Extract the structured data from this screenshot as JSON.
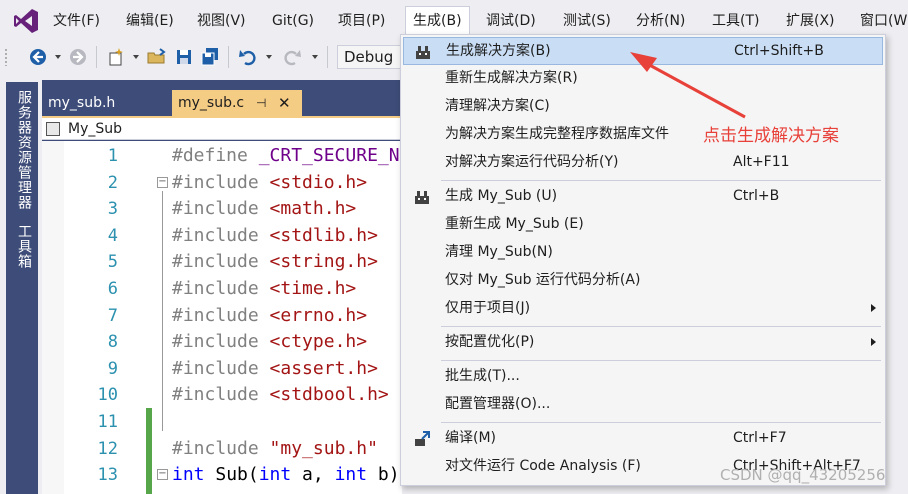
{
  "menubar": {
    "items": [
      "文件(F)",
      "编辑(E)",
      "视图(V)",
      "Git(G)",
      "项目(P)",
      "生成(B)",
      "调试(D)",
      "测试(S)",
      "分析(N)",
      "工具(T)",
      "扩展(X)",
      "窗口(W)"
    ],
    "active_index": 5
  },
  "toolbar": {
    "configuration": "Debug",
    "icons": [
      "back-icon",
      "forward-icon",
      "new-project-icon",
      "open-folder-icon",
      "save-icon",
      "save-all-icon",
      "undo-icon",
      "redo-icon"
    ]
  },
  "left_strip": {
    "server_explorer": "服务器资源管理器",
    "toolbox": "工具箱"
  },
  "tabs": [
    {
      "label": "my_sub.h",
      "active": false
    },
    {
      "label": "my_sub.c",
      "active": true
    }
  ],
  "navbar": {
    "scope": "My_Sub"
  },
  "code_lines": [
    {
      "n": "1",
      "fold": false,
      "parts": [
        {
          "c": "pp",
          "t": "#define "
        },
        {
          "c": "macro",
          "t": "_CRT_SECURE_NO"
        }
      ]
    },
    {
      "n": "2",
      "fold": true,
      "parts": [
        {
          "c": "pp",
          "t": "#include "
        },
        {
          "c": "hdr",
          "t": "<stdio.h>"
        }
      ]
    },
    {
      "n": "3",
      "fold": false,
      "parts": [
        {
          "c": "pp",
          "t": "#include "
        },
        {
          "c": "hdr",
          "t": "<math.h>"
        }
      ]
    },
    {
      "n": "4",
      "fold": false,
      "parts": [
        {
          "c": "pp",
          "t": "#include "
        },
        {
          "c": "hdr",
          "t": "<stdlib.h>"
        }
      ]
    },
    {
      "n": "5",
      "fold": false,
      "parts": [
        {
          "c": "pp",
          "t": "#include "
        },
        {
          "c": "hdr",
          "t": "<string.h>"
        }
      ]
    },
    {
      "n": "6",
      "fold": false,
      "parts": [
        {
          "c": "pp",
          "t": "#include "
        },
        {
          "c": "hdr",
          "t": "<time.h>"
        }
      ]
    },
    {
      "n": "7",
      "fold": false,
      "parts": [
        {
          "c": "pp",
          "t": "#include "
        },
        {
          "c": "hdr",
          "t": "<errno.h>"
        }
      ]
    },
    {
      "n": "8",
      "fold": false,
      "parts": [
        {
          "c": "pp",
          "t": "#include "
        },
        {
          "c": "hdr",
          "t": "<ctype.h>"
        }
      ]
    },
    {
      "n": "9",
      "fold": false,
      "parts": [
        {
          "c": "pp",
          "t": "#include "
        },
        {
          "c": "hdr",
          "t": "<assert.h>"
        }
      ]
    },
    {
      "n": "10",
      "fold": false,
      "parts": [
        {
          "c": "pp",
          "t": "#include "
        },
        {
          "c": "hdr",
          "t": "<stdbool.h>"
        }
      ]
    },
    {
      "n": "11",
      "fold": false,
      "parts": []
    },
    {
      "n": "12",
      "fold": false,
      "parts": [
        {
          "c": "pp",
          "t": "#include "
        },
        {
          "c": "hdr",
          "t": "\"my_sub.h\""
        }
      ]
    },
    {
      "n": "13",
      "fold": true,
      "parts": [
        {
          "c": "kw",
          "t": "int"
        },
        {
          "c": "plain",
          "t": " Sub("
        },
        {
          "c": "kw",
          "t": "int"
        },
        {
          "c": "plain",
          "t": " a, "
        },
        {
          "c": "kw",
          "t": "int"
        },
        {
          "c": "plain",
          "t": " b)"
        }
      ]
    }
  ],
  "build_menu": {
    "items": [
      {
        "label": "生成解决方案(B)",
        "shortcut": "Ctrl+Shift+B",
        "icon": "build-icon",
        "highlight": true
      },
      {
        "label": "重新生成解决方案(R)",
        "shortcut": ""
      },
      {
        "label": "清理解决方案(C)",
        "shortcut": ""
      },
      {
        "label": "为解决方案生成完整程序数据库文件",
        "shortcut": ""
      },
      {
        "label": "对解决方案运行代码分析(Y)",
        "shortcut": "Alt+F11"
      },
      {
        "sep": true
      },
      {
        "label": "生成 My_Sub (U)",
        "shortcut": "Ctrl+B",
        "icon": "build-icon"
      },
      {
        "label": "重新生成 My_Sub (E)",
        "shortcut": ""
      },
      {
        "label": "清理 My_Sub(N)",
        "shortcut": ""
      },
      {
        "label": "仅对 My_Sub 运行代码分析(A)",
        "shortcut": ""
      },
      {
        "label": "仅用于项目(J)",
        "shortcut": "",
        "submenu": true
      },
      {
        "sep": true
      },
      {
        "label": "按配置优化(P)",
        "shortcut": "",
        "submenu": true
      },
      {
        "sep": true
      },
      {
        "label": "批生成(T)...",
        "shortcut": ""
      },
      {
        "label": "配置管理器(O)...",
        "shortcut": ""
      },
      {
        "sep": true
      },
      {
        "label": "编译(M)",
        "shortcut": "Ctrl+F7",
        "icon": "compile-icon"
      },
      {
        "label": "对文件运行 Code Analysis (F)",
        "shortcut": "Ctrl+Shift+Alt+F7"
      }
    ]
  },
  "annotation": {
    "text": "点击生成解决方案",
    "color": "#e8413a"
  },
  "watermark": "CSDN @qq_43205256",
  "colors": {
    "accent_purple": "#68217a",
    "tab_active": "#f5cc84",
    "frame_blue": "#3d4c78",
    "menu_highlight": "#c9def5",
    "change_bar": "#57a64a"
  }
}
